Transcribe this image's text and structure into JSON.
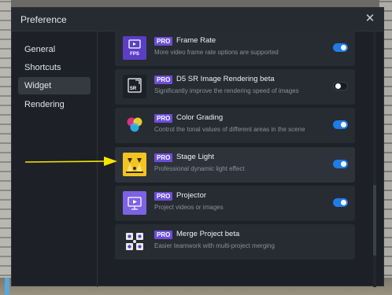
{
  "window": {
    "title": "Preference",
    "close_symbol": "✕"
  },
  "sidebar": {
    "items": [
      {
        "label": "General",
        "active": false
      },
      {
        "label": "Shortcuts",
        "active": false
      },
      {
        "label": "Widget",
        "active": true
      },
      {
        "label": "Rendering",
        "active": false
      }
    ]
  },
  "widgets": [
    {
      "icon": "fps-icon",
      "badge": "PRO",
      "title": "Frame Rate",
      "description": "More video frame rate options are supported",
      "enabled": true
    },
    {
      "icon": "sr-image-icon",
      "badge": "PRO",
      "title": "D5 SR Image Rendering beta",
      "description": "Significantly improve the rendering speed of images",
      "enabled": false
    },
    {
      "icon": "color-circles-icon",
      "badge": "PRO",
      "title": "Color Grading",
      "description": "Control the tonal values of different areas in the scene",
      "enabled": true
    },
    {
      "icon": "stage-light-icon",
      "badge": "PRO",
      "title": "Stage Light",
      "description": "Professional dynamic light effect",
      "enabled": true
    },
    {
      "icon": "projector-icon",
      "badge": "PRO",
      "title": "Projector",
      "description": "Project videos or images",
      "enabled": true
    },
    {
      "icon": "merge-project-icon",
      "badge": "PRO",
      "title": "Merge Project beta",
      "description": "Easier teamwork with multi-project merging",
      "enabled": null
    }
  ],
  "icon_labels": {
    "fps": "FPS",
    "sr": "SR"
  },
  "colors": {
    "accent": "#1f7be8",
    "pro_badge": "#6b4ed8",
    "annotation_arrow": "#f5e400"
  }
}
